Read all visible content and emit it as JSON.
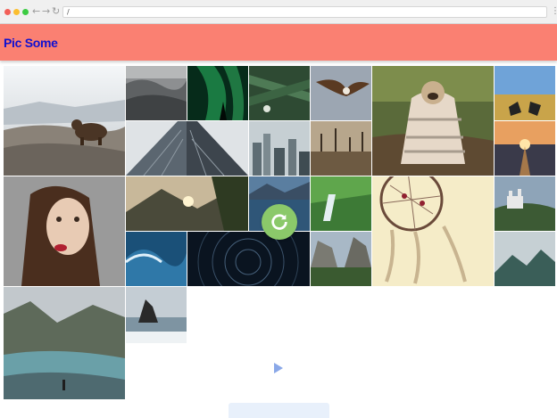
{
  "browser": {
    "url": "/",
    "back_glyph": "←",
    "forward_glyph": "→",
    "reload_glyph": "↻",
    "menu_glyph": "⋮"
  },
  "app": {
    "title": "Pic Some",
    "header_color": "#fa8072",
    "title_color": "#1010d0"
  },
  "gallery": {
    "images": [
      {
        "name": "photo-bear-on-rocks",
        "size": "tall"
      },
      {
        "name": "photo-misty-forest-bw",
        "size": "small"
      },
      {
        "name": "photo-aurora-green",
        "size": "small"
      },
      {
        "name": "photo-pine-branches",
        "size": "small"
      },
      {
        "name": "photo-eagle-flying",
        "size": "small"
      },
      {
        "name": "photo-pug-in-blanket",
        "size": "big"
      },
      {
        "name": "photo-feet-on-field",
        "size": "small"
      },
      {
        "name": "photo-skyscraper-upward",
        "size": "wide"
      },
      {
        "name": "photo-city-skyline",
        "size": "small"
      },
      {
        "name": "photo-dead-trees-lake",
        "size": "small"
      },
      {
        "name": "photo-sunset-road",
        "size": "small"
      },
      {
        "name": "photo-woman-portrait",
        "size": "tall"
      },
      {
        "name": "photo-mountain-sunset",
        "size": "wide"
      },
      {
        "name": "photo-lake-mountains",
        "size": "small"
      },
      {
        "name": "photo-waterfall-green",
        "size": "small"
      },
      {
        "name": "photo-dreamcatcher",
        "size": "big"
      },
      {
        "name": "photo-castle-mountain",
        "size": "small"
      },
      {
        "name": "photo-ocean-wave",
        "size": "small"
      },
      {
        "name": "photo-star-trails",
        "size": "wide"
      },
      {
        "name": "photo-yosemite-valley",
        "size": "small"
      },
      {
        "name": "photo-misty-peaks",
        "size": "small"
      },
      {
        "name": "photo-river-mist-hiker",
        "size": "tall"
      },
      {
        "name": "photo-rock-in-sea",
        "size": "small"
      }
    ]
  },
  "refresh_button": {
    "icon": "refresh-icon",
    "color": "#8bc96a"
  }
}
